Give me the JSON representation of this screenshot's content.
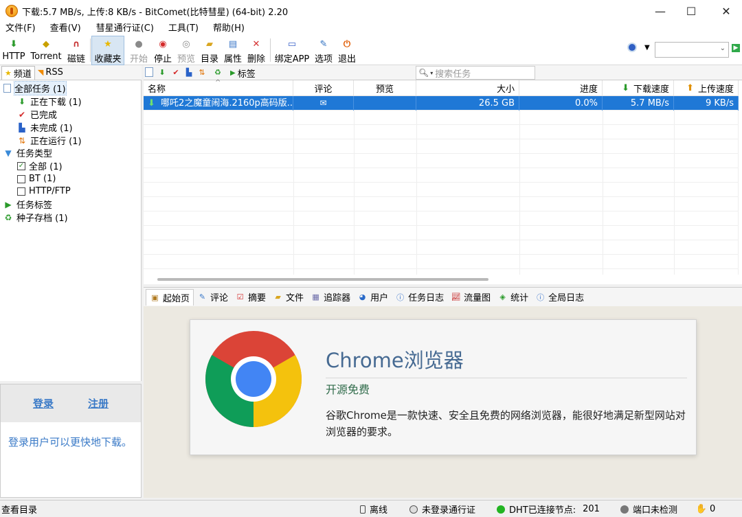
{
  "window": {
    "title": "下载:5.7 MB/s, 上传:8 KB/s - BitComet(比特彗星) (64-bit) 2.20",
    "minimize_glyph": "—",
    "maximize_glyph": "☐",
    "close_glyph": "✕"
  },
  "menu": [
    "文件(F)",
    "查看(V)",
    "彗星通行证(C)",
    "工具(T)",
    "帮助(H)"
  ],
  "toolbar": {
    "http": "HTTP",
    "torrent": "Torrent",
    "magnet": "磁链",
    "favorites": "收藏夹",
    "start": "开始",
    "stop": "停止",
    "preview": "预览",
    "directory": "目录",
    "properties": "属性",
    "delete": "删除",
    "bind_app": "绑定APP",
    "options": "选项",
    "exit": "退出"
  },
  "left_tabs": {
    "channel": "频道",
    "rss": "RSS"
  },
  "tree": {
    "all_tasks": "全部任务 (1)",
    "downloading": "正在下载 (1)",
    "completed": "已完成",
    "incomplete": "未完成 (1)",
    "running": "正在运行 (1)",
    "task_type": "任务类型",
    "type_all": "全部 (1)",
    "type_bt": "BT (1)",
    "type_http": "HTTP/FTP",
    "task_tags": "任务标签",
    "torrent_archive": "种子存档 (1)"
  },
  "login": {
    "login": "登录",
    "register": "注册",
    "message": "登录用户可以更快地下载。"
  },
  "tasks_toolbar": {
    "tags": "标签",
    "search_placeholder": "搜索任务"
  },
  "grid": {
    "columns": {
      "name": "名称",
      "comment": "评论",
      "preview": "预览",
      "size": "大小",
      "progress": "进度",
      "down_speed": "下载速度",
      "up_speed": "上传速度"
    },
    "rows": [
      {
        "name": "哪吒2之魔童闹海.2160p高码版...",
        "size": "26.5 GB",
        "progress": "0.0%",
        "down_speed": "5.7 MB/s",
        "up_speed": "9 KB/s"
      }
    ]
  },
  "bottom_tabs": [
    "起始页",
    "评论",
    "摘要",
    "文件",
    "追踪器",
    "用户",
    "任务日志",
    "流量图",
    "统计",
    "全局日志"
  ],
  "card": {
    "title": "Chrome浏览器",
    "subtitle": "开源免费",
    "description": "谷歌Chrome是一款快速、安全且免费的网络浏览器，能很好地满足新型网站对浏览器的要求。"
  },
  "status": {
    "left": "查看目录",
    "offline": "离线",
    "passport": "未登录通行证",
    "dht": "DHT已连接节点:",
    "dht_count": "201",
    "port": "端口未检测",
    "count": "0"
  },
  "colors": {
    "selection": "#1f78d6",
    "link": "#3a7ac7",
    "card_title": "#466a92",
    "card_subtitle": "#2f6b4a",
    "content_bg": "#ece9e1"
  }
}
